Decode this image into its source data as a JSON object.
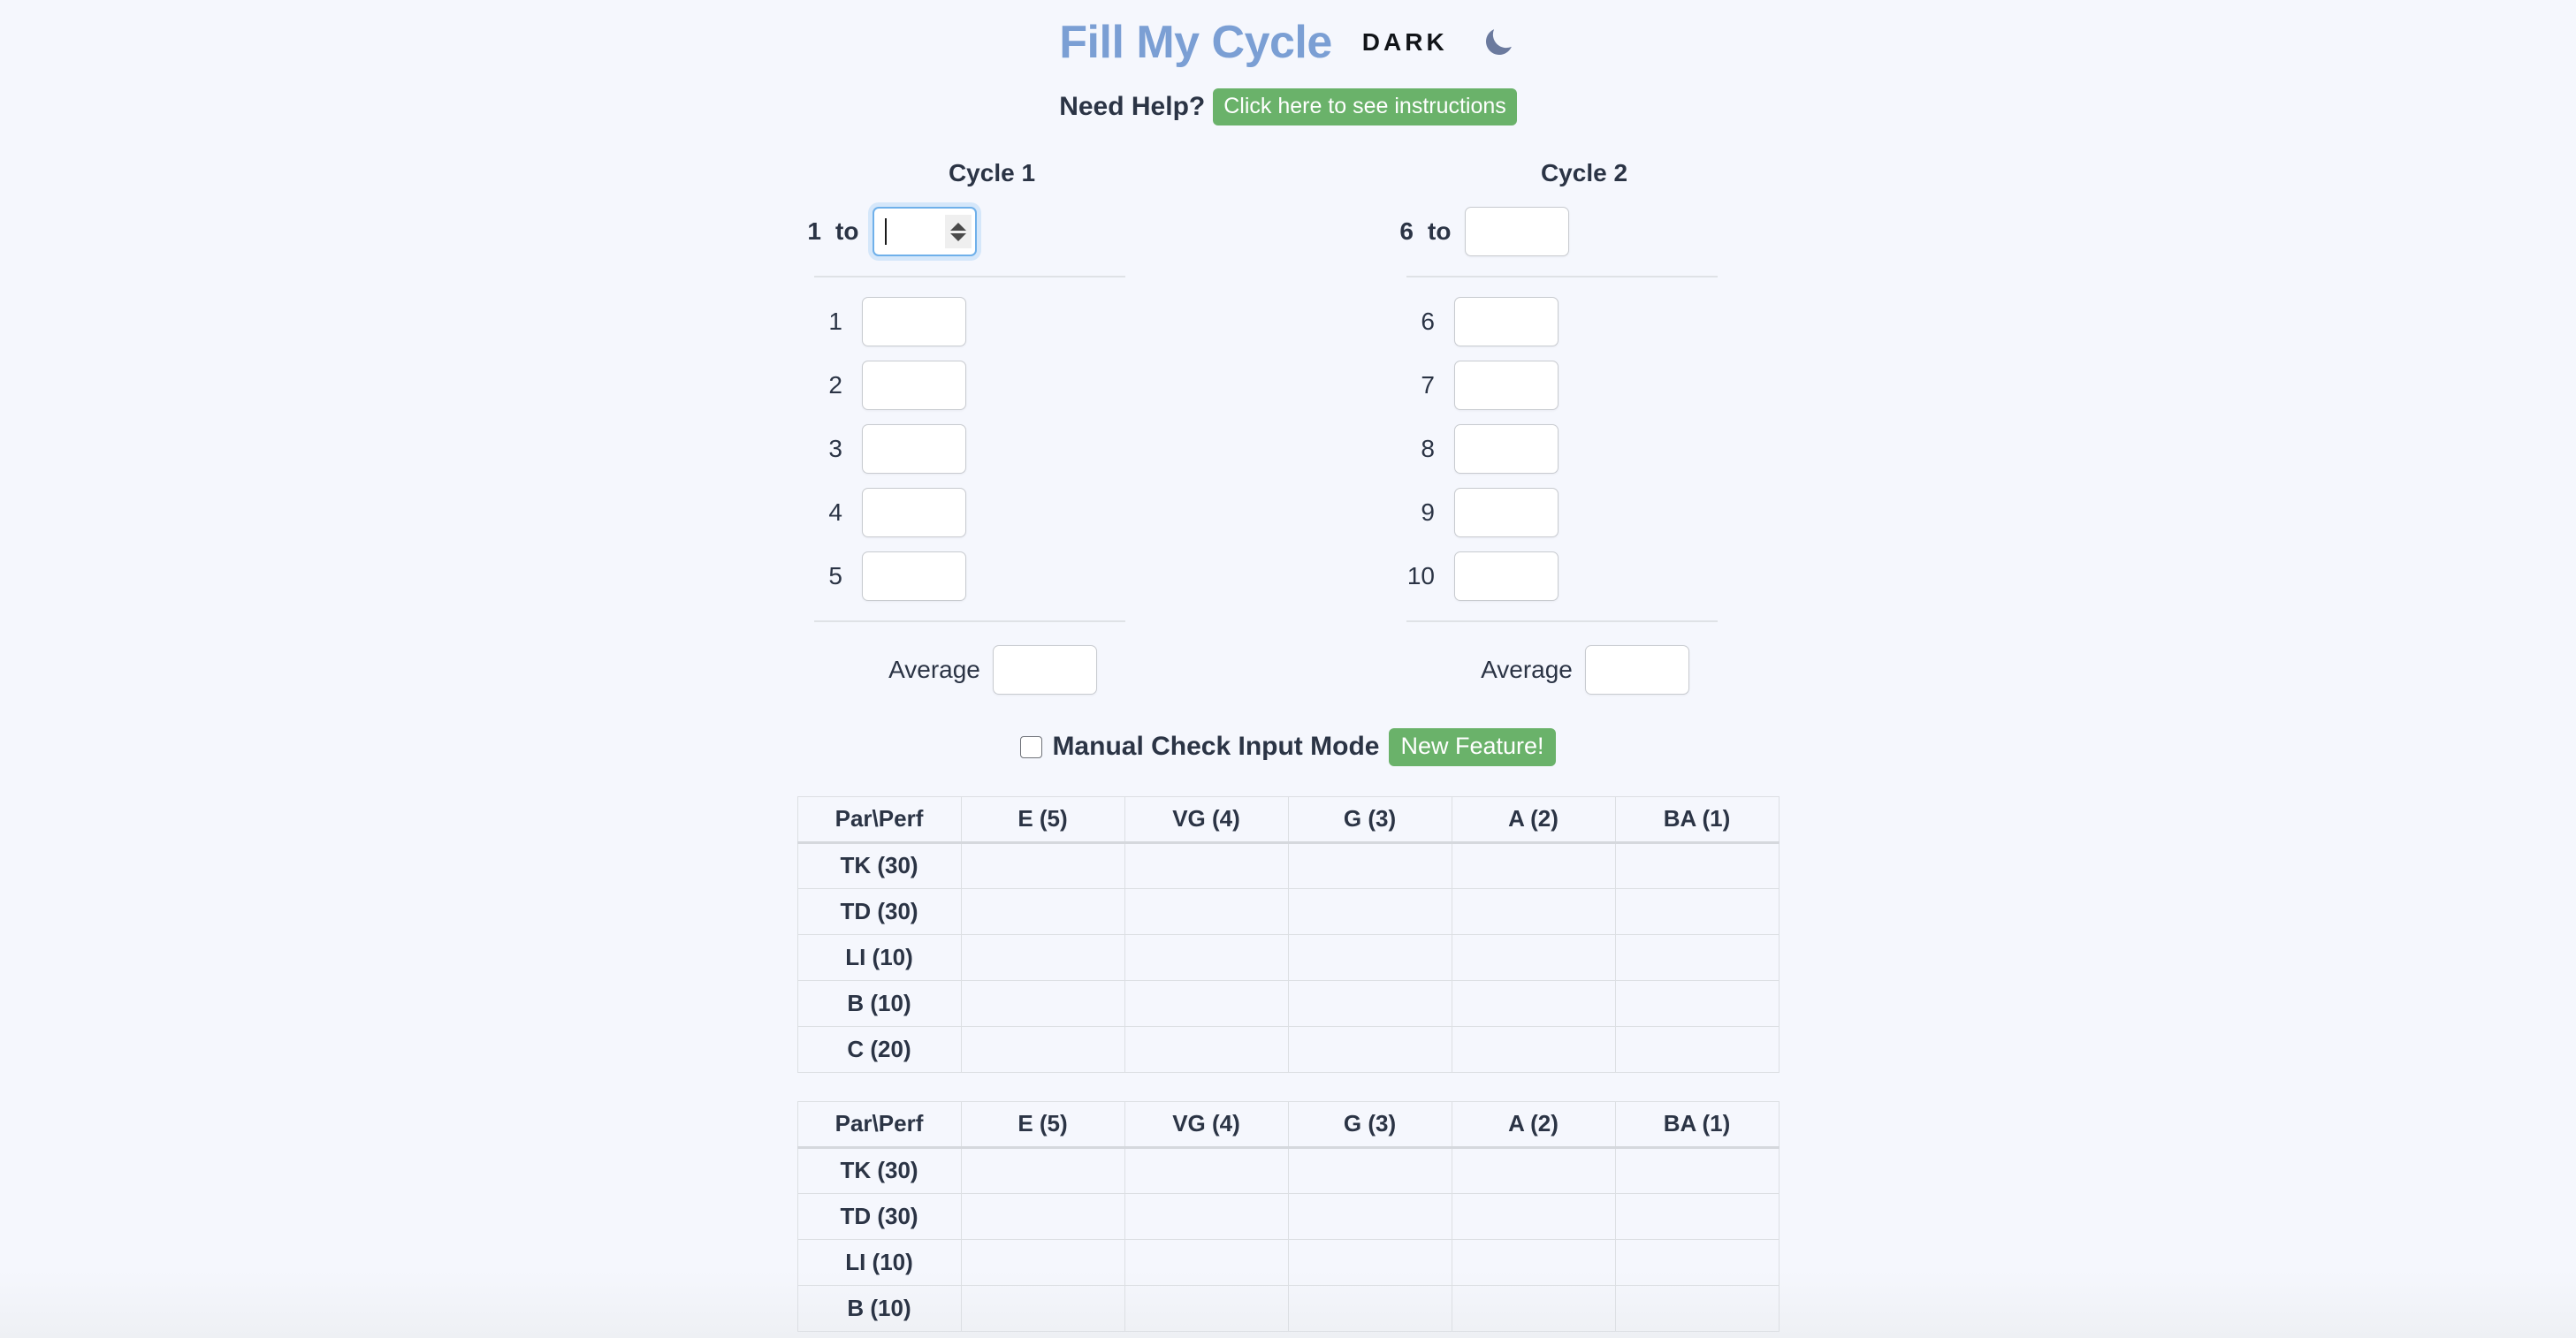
{
  "header": {
    "title": "Fill My Cycle",
    "dark_label": "DARK",
    "moon_icon": "moon-icon",
    "title_color": "#7b9fd4",
    "moon_color": "#6b7a9e"
  },
  "help": {
    "prompt": "Need Help?",
    "button_label": "Click here to see instructions",
    "button_color": "#6ab26a"
  },
  "cycles": [
    {
      "title": "Cycle 1",
      "range_start": "1",
      "range_to_label": "to",
      "range_end_value": "",
      "range_end_focused": true,
      "rows": [
        {
          "label": "1",
          "value": ""
        },
        {
          "label": "2",
          "value": ""
        },
        {
          "label": "3",
          "value": ""
        },
        {
          "label": "4",
          "value": ""
        },
        {
          "label": "5",
          "value": ""
        }
      ],
      "average_label": "Average",
      "average_value": ""
    },
    {
      "title": "Cycle 2",
      "range_start": "6",
      "range_to_label": "to",
      "range_end_value": "",
      "range_end_focused": false,
      "rows": [
        {
          "label": "6",
          "value": ""
        },
        {
          "label": "7",
          "value": ""
        },
        {
          "label": "8",
          "value": ""
        },
        {
          "label": "9",
          "value": ""
        },
        {
          "label": "10",
          "value": ""
        }
      ],
      "average_label": "Average",
      "average_value": ""
    }
  ],
  "manual_check": {
    "checked": false,
    "label": "Manual Check Input Mode",
    "badge": "New Feature!",
    "badge_color": "#6ab26a"
  },
  "tables": [
    {
      "headers": [
        "Par\\Perf",
        "E (5)",
        "VG (4)",
        "G (3)",
        "A (2)",
        "BA (1)"
      ],
      "rows": [
        {
          "label": "TK (30)",
          "cells": [
            "",
            "",
            "",
            "",
            ""
          ]
        },
        {
          "label": "TD (30)",
          "cells": [
            "",
            "",
            "",
            "",
            ""
          ]
        },
        {
          "label": "LI (10)",
          "cells": [
            "",
            "",
            "",
            "",
            ""
          ]
        },
        {
          "label": "B (10)",
          "cells": [
            "",
            "",
            "",
            "",
            ""
          ]
        },
        {
          "label": "C (20)",
          "cells": [
            "",
            "",
            "",
            "",
            ""
          ]
        }
      ]
    },
    {
      "headers": [
        "Par\\Perf",
        "E (5)",
        "VG (4)",
        "G (3)",
        "A (2)",
        "BA (1)"
      ],
      "rows": [
        {
          "label": "TK (30)",
          "cells": [
            "",
            "",
            "",
            "",
            ""
          ]
        },
        {
          "label": "TD (30)",
          "cells": [
            "",
            "",
            "",
            "",
            ""
          ]
        },
        {
          "label": "LI (10)",
          "cells": [
            "",
            "",
            "",
            "",
            ""
          ]
        },
        {
          "label": "B (10)",
          "cells": [
            "",
            "",
            "",
            "",
            ""
          ]
        }
      ]
    }
  ]
}
